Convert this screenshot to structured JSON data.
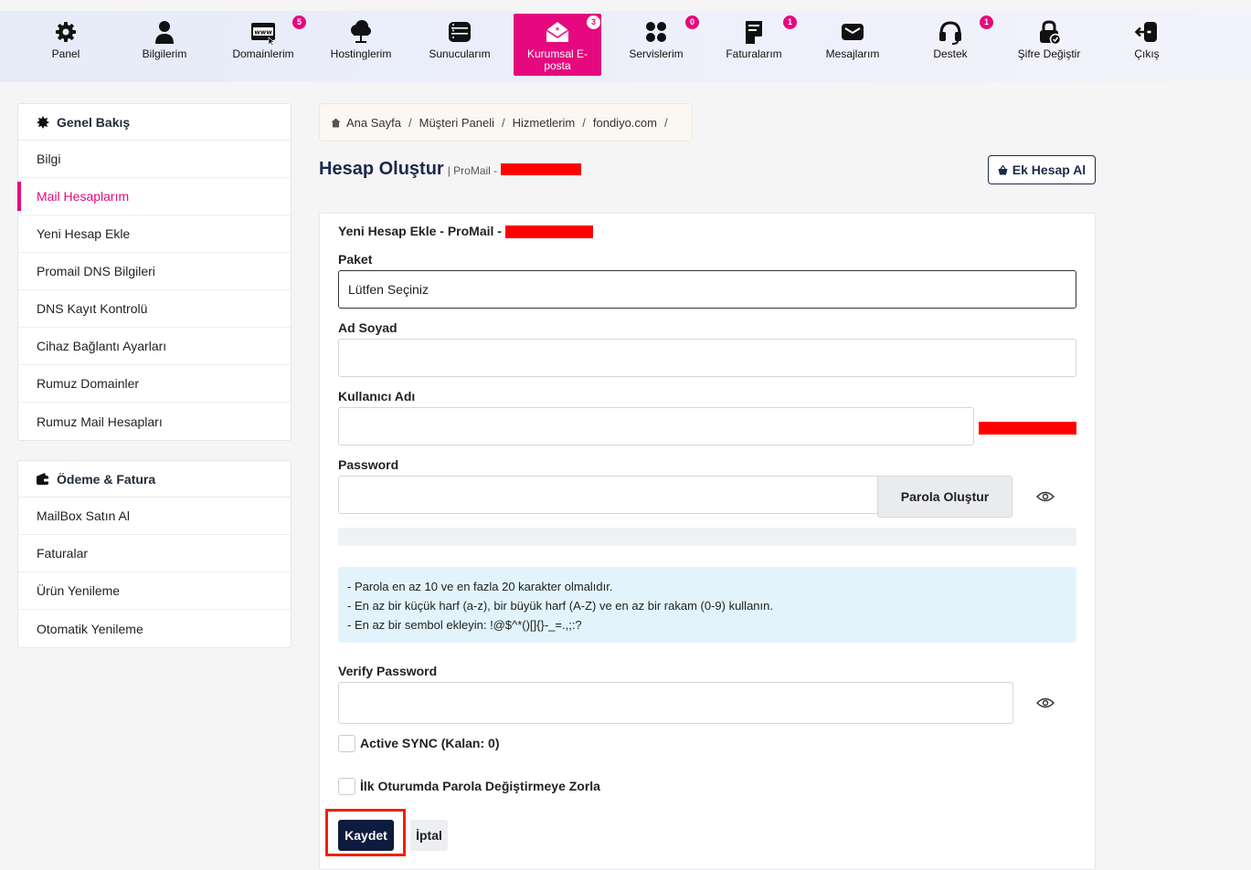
{
  "nav": {
    "items": [
      {
        "label": "Panel",
        "icon": "gear-icon",
        "badge": ""
      },
      {
        "label": "Bilgilerim",
        "icon": "user-icon",
        "badge": ""
      },
      {
        "label": "Domainlerim",
        "icon": "www-icon",
        "badge": "5"
      },
      {
        "label": "Hostinglerim",
        "icon": "cloud-icon",
        "badge": ""
      },
      {
        "label": "Sunucularım",
        "icon": "server-icon",
        "badge": ""
      },
      {
        "label": "Kurumsal E-posta",
        "icon": "mail-open-icon",
        "badge": "3"
      },
      {
        "label": "Servislerim",
        "icon": "grid-icon",
        "badge": "0"
      },
      {
        "label": "Faturalarım",
        "icon": "receipt-icon",
        "badge": "1"
      },
      {
        "label": "Mesajlarım",
        "icon": "envelope-icon",
        "badge": ""
      },
      {
        "label": "Destek",
        "icon": "headset-icon",
        "badge": "1"
      },
      {
        "label": "Şifre Değiştir",
        "icon": "lock-icon",
        "badge": ""
      },
      {
        "label": "Çıkış",
        "icon": "logout-icon",
        "badge": ""
      }
    ],
    "active_color": "#e5087e"
  },
  "sidebar": {
    "overview": {
      "title": "Genel Bakış",
      "items": [
        "Bilgi",
        "Mail Hesaplarım",
        "Yeni Hesap Ekle",
        "Promail DNS Bilgileri",
        "DNS Kayıt Kontrolü",
        "Cihaz Bağlantı Ayarları",
        "Rumuz Domainler",
        "Rumuz Mail Hesapları"
      ]
    },
    "billing": {
      "title": "Ödeme & Fatura",
      "items": [
        "MailBox Satın Al",
        "Faturalar",
        "Ürün Yenileme",
        "Otomatik Yenileme"
      ]
    }
  },
  "breadcrumb": [
    "Ana Sayfa",
    "Müşteri Paneli",
    "Hizmetlerim",
    "fondiyo.com"
  ],
  "header": {
    "title": "Hesap Oluştur",
    "subtitle": "| ProMail -",
    "ek_hesap_label": "Ek Hesap Al"
  },
  "form": {
    "card_title": "Yeni Hesap Ekle - ProMail -",
    "paket_label": "Paket",
    "paket_value": "Lütfen Seçiniz",
    "adsoyad_label": "Ad Soyad",
    "adsoyad_value": "",
    "kullanici_label": "Kullanıcı Adı",
    "kullanici_value": "",
    "password_label": "Password",
    "password_value": "",
    "parola_button": "Parola Oluştur",
    "rules": [
      "- Parola en az 10 ve en fazla 20 karakter olmalıdır.",
      "- En az bir küçük harf (a-z), bir büyük harf (A-Z) ve en az bir rakam (0-9) kullanın.",
      "- En az bir sembol ekleyin: !@$^*()[]{}-_=.,;:?"
    ],
    "verify_label": "Verify Password",
    "verify_value": "",
    "sync_label": "Active SYNC (Kalan: 0)",
    "force_label": "İlk Oturumda Parola Değiştirmeye Zorla",
    "save_label": "Kaydet",
    "cancel_label": "İptal"
  }
}
